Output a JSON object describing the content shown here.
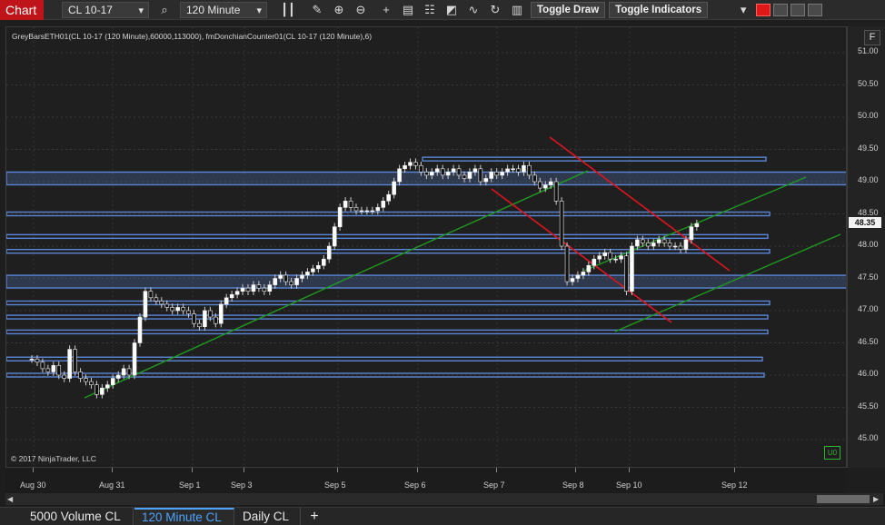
{
  "toolbar": {
    "chart_label": "Chart",
    "instrument": "CL 10-17",
    "interval": "120 Minute",
    "toggle_draw": "Toggle Draw",
    "toggle_indicators": "Toggle Indicators",
    "accent_color": "#c0141b"
  },
  "plot": {
    "indicator_label": "GreyBarsETH01(CL 10-17 (120 Minute),60000,113000), fmDonchianCounter01(CL 10-17 (120 Minute),6)",
    "copyright": "© 2017 NinjaTrader, LLC",
    "badge": "U0",
    "f_button": "F",
    "last_price": "48.35"
  },
  "chart_data": {
    "type": "candlestick",
    "y_ticks": [
      "51.00",
      "50.50",
      "50.00",
      "49.50",
      "49.00",
      "48.50",
      "48.00",
      "47.50",
      "47.00",
      "46.50",
      "46.00",
      "45.50",
      "45.00"
    ],
    "x_ticks": [
      "Aug 30",
      "Aug 31",
      "Sep 1",
      "Sep 3",
      "Sep 5",
      "Sep 6",
      "Sep 7",
      "Sep 8",
      "Sep 10",
      "Sep 12"
    ],
    "ylim": [
      44.85,
      51.35
    ],
    "horizontal_levels": [
      49.35,
      49.05,
      48.5,
      48.15,
      47.92,
      47.45,
      47.12,
      46.9,
      46.67,
      46.25,
      46.0
    ],
    "colors": {
      "up": "#ffffff",
      "down": "#ffffff",
      "wick": "#cccccc",
      "level": "#5b86d6",
      "green_line": "#1f9a1f",
      "red_line": "#e0141e"
    }
  },
  "tabs": [
    {
      "label": "5000 Volume CL"
    },
    {
      "label": "120 Minute CL"
    },
    {
      "label": "Daily CL"
    }
  ]
}
